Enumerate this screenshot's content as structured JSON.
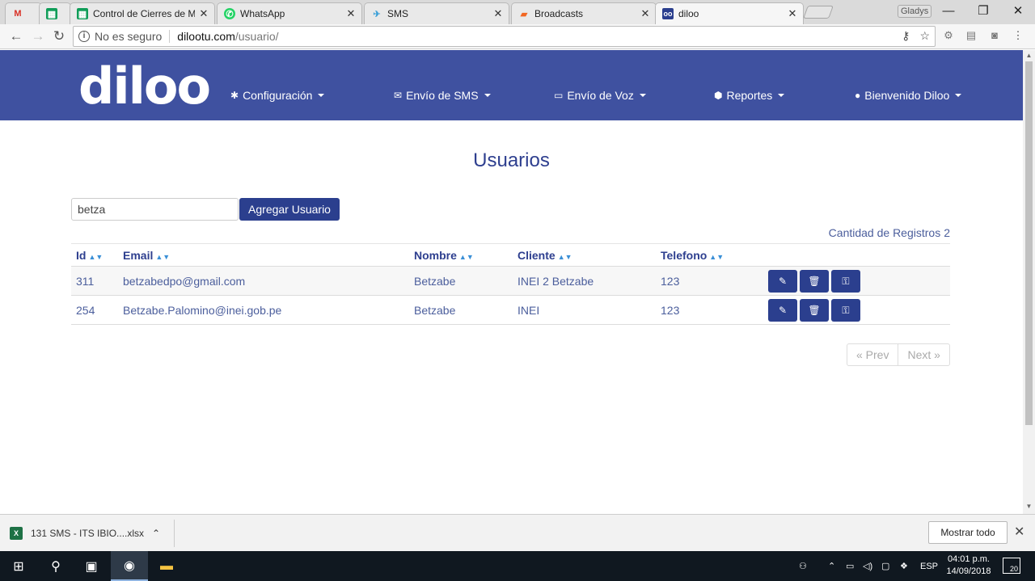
{
  "browser": {
    "tabs": [
      {
        "title": "",
        "icon": "gmail-icon",
        "glyph": "M"
      },
      {
        "title": "",
        "icon": "sheets-icon",
        "glyph": "▦"
      },
      {
        "title": "Control de Cierres de Me",
        "icon": "sheets-icon",
        "glyph": "▦"
      },
      {
        "title": "WhatsApp",
        "icon": "whatsapp-icon",
        "glyph": "✆"
      },
      {
        "title": "SMS",
        "icon": "sms-icon",
        "glyph": "✈"
      },
      {
        "title": "Broadcasts",
        "icon": "broadcasts-icon",
        "glyph": "▰"
      },
      {
        "title": "diloo",
        "icon": "diloo-icon",
        "glyph": "oo"
      }
    ],
    "profile_name": "Gladys",
    "url_security": "No es seguro",
    "url_host": "dilootu.com",
    "url_path": "/usuario/"
  },
  "navbar": {
    "logo": "diloo",
    "items": [
      {
        "label": "Configuración",
        "icon": "gear-icon"
      },
      {
        "label": "Envío de SMS",
        "icon": "envelope-icon"
      },
      {
        "label": "Envío de Voz",
        "icon": "laptop-icon"
      },
      {
        "label": "Reportes",
        "icon": "cube-icon"
      },
      {
        "label": "Bienvenido Diloo",
        "icon": "user-icon"
      }
    ]
  },
  "main": {
    "title": "Usuarios",
    "search_value": "betza",
    "add_button": "Agregar Usuario",
    "count_label": "Cantidad de Registros",
    "count_value": "2",
    "columns": [
      "Id",
      "Email",
      "Nombre",
      "Cliente",
      "Telefono"
    ],
    "rows": [
      {
        "id": "311",
        "email": "betzabedpo@gmail.com",
        "nombre": "Betzabe",
        "cliente": "INEI 2 Betzabe",
        "telefono": "123"
      },
      {
        "id": "254",
        "email": "Betzabe.Palomino@inei.gob.pe",
        "nombre": "Betzabe",
        "cliente": "INEI",
        "telefono": "123"
      }
    ],
    "pager": {
      "prev": "« Prev",
      "next": "Next »"
    }
  },
  "download_bar": {
    "file_name": "131 SMS - ITS IBIO....xlsx",
    "show_all": "Mostrar todo"
  },
  "taskbar": {
    "language": "ESP",
    "time": "04:01 p.m.",
    "date": "14/09/2018",
    "notifications": "20"
  },
  "colors": {
    "navbar": "#3f51a0",
    "primary_button": "#2b3f8e",
    "title_text": "#2e3f8f"
  }
}
